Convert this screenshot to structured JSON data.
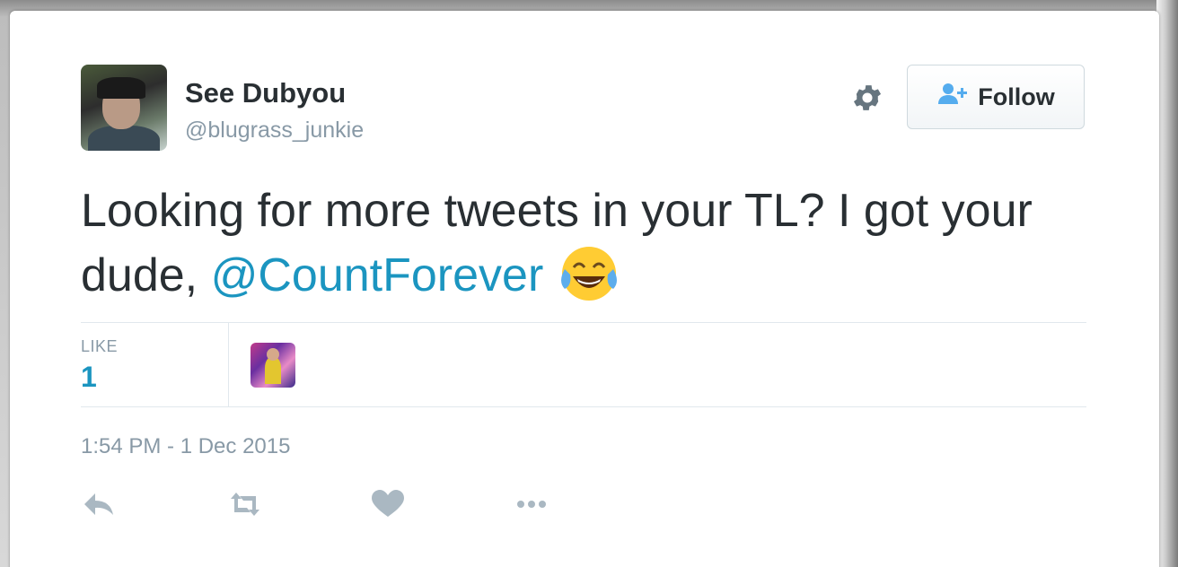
{
  "tweet": {
    "author": {
      "name": "See Dubyou",
      "handle": "@blugrass_junkie"
    },
    "follow_label": "Follow",
    "text_before": "Looking for more tweets in your TL? I got your dude, ",
    "mention": "@CountForever",
    "emoji": "face-with-tears-of-joy",
    "likes": {
      "label": "LIKE",
      "count": "1"
    },
    "timestamp": "1:54 PM - 1 Dec 2015"
  },
  "icons": {
    "settings": "gear-icon",
    "follow": "add-user-icon",
    "reply": "reply-icon",
    "retweet": "retweet-icon",
    "like": "heart-icon",
    "more": "more-icon"
  },
  "colors": {
    "text": "#292f33",
    "muted": "#8899a6",
    "link": "#1b95c0",
    "follow_icon": "#55acee",
    "divider": "#e1e8ed",
    "action_icon": "#aab8c2"
  }
}
